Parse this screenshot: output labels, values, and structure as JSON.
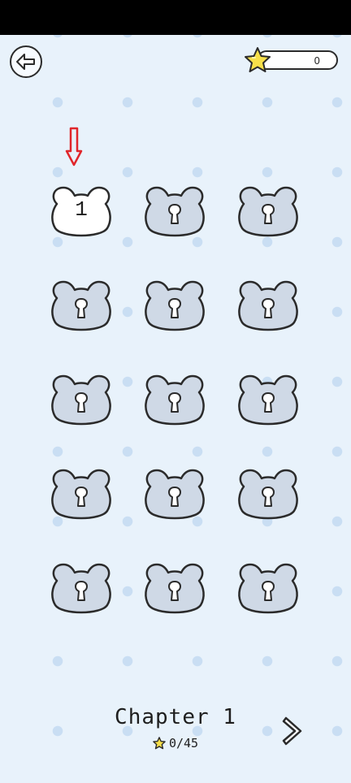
{
  "header": {
    "star_total": "0"
  },
  "levels": [
    {
      "number": "1",
      "state": "unlocked"
    },
    {
      "number": "",
      "state": "locked"
    },
    {
      "number": "",
      "state": "locked"
    },
    {
      "number": "",
      "state": "locked"
    },
    {
      "number": "",
      "state": "locked"
    },
    {
      "number": "",
      "state": "locked"
    },
    {
      "number": "",
      "state": "locked"
    },
    {
      "number": "",
      "state": "locked"
    },
    {
      "number": "",
      "state": "locked"
    },
    {
      "number": "",
      "state": "locked"
    },
    {
      "number": "",
      "state": "locked"
    },
    {
      "number": "",
      "state": "locked"
    },
    {
      "number": "",
      "state": "locked"
    },
    {
      "number": "",
      "state": "locked"
    },
    {
      "number": "",
      "state": "locked"
    }
  ],
  "footer": {
    "chapter_title": "Chapter 1",
    "chapter_stars": "0/45"
  },
  "colors": {
    "background": "#e8f2fb",
    "dot": "#c9def3",
    "locked_bear": "#cfd9e6",
    "unlocked_bear": "#ffffff",
    "outline": "#2b2b2b",
    "star": "#f7e04a",
    "hint_arrow": "#e0262b"
  },
  "icons": {
    "back": "arrow-left-icon",
    "star": "star-icon",
    "hint": "arrow-down-icon",
    "lock": "keyhole-icon",
    "next": "chevron-right-icon"
  }
}
